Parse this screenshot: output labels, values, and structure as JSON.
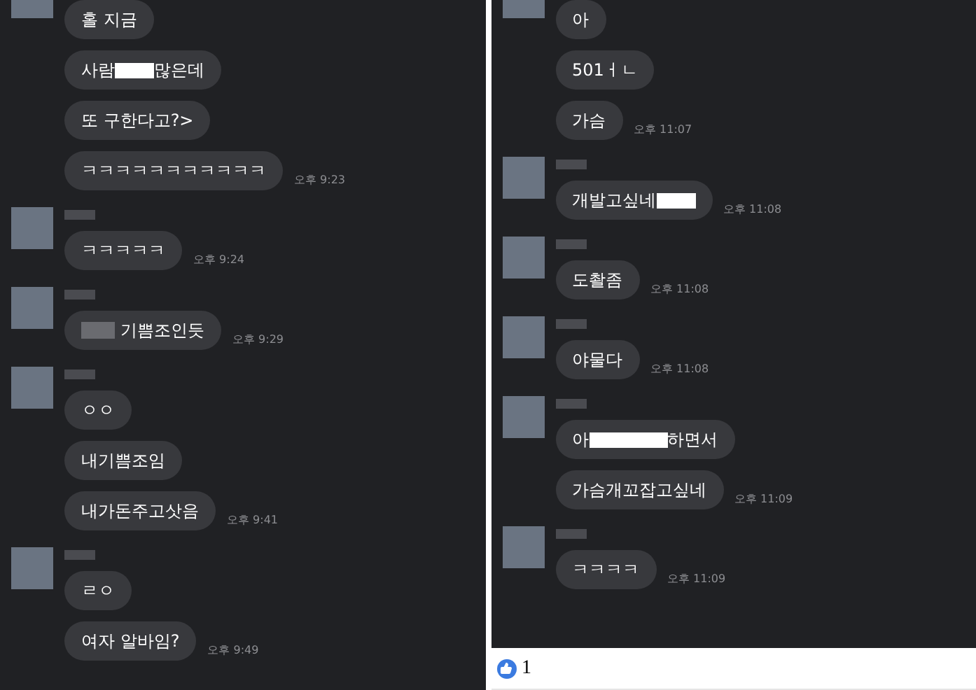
{
  "panels": [
    {
      "groups": [
        {
          "messages": [
            {
              "parts": [
                {
                  "kind": "text",
                  "text": "홀 지금"
                }
              ]
            },
            {
              "parts": [
                {
                  "kind": "text",
                  "text": "사람 "
                },
                {
                  "kind": "redacted"
                },
                {
                  "kind": "text",
                  "text": "많은데"
                }
              ]
            },
            {
              "parts": [
                {
                  "kind": "text",
                  "text": "또 구한다고?>"
                }
              ]
            },
            {
              "parts": [
                {
                  "kind": "text",
                  "text": "ㅋㅋㅋㅋㅋㅋㅋㅋㅋㅋㅋ"
                }
              ],
              "time": "오후 9:23"
            }
          ]
        },
        {
          "messages": [
            {
              "parts": [
                {
                  "kind": "text",
                  "text": "ㅋㅋㅋㅋㅋ"
                }
              ],
              "time": "오후 9:24"
            }
          ]
        },
        {
          "messages": [
            {
              "parts": [
                {
                  "kind": "blurred"
                },
                {
                  "kind": "text",
                  "text": "기쁨조인듯"
                }
              ],
              "time": "오후 9:29"
            }
          ]
        },
        {
          "messages": [
            {
              "parts": [
                {
                  "kind": "text",
                  "text": "ㅇㅇ"
                }
              ]
            },
            {
              "parts": [
                {
                  "kind": "text",
                  "text": "내기쁨조임"
                }
              ]
            },
            {
              "parts": [
                {
                  "kind": "text",
                  "text": "내가돈주고삿음"
                }
              ],
              "time": "오후 9:41"
            }
          ]
        },
        {
          "messages": [
            {
              "parts": [
                {
                  "kind": "text",
                  "text": "ㄹㅇ"
                }
              ]
            },
            {
              "parts": [
                {
                  "kind": "text",
                  "text": "여자 알바임?"
                }
              ],
              "time": "오후 9:49"
            }
          ]
        }
      ]
    },
    {
      "groups": [
        {
          "messages": [
            {
              "parts": [
                {
                  "kind": "text",
                  "text": "아"
                }
              ]
            },
            {
              "parts": [
                {
                  "kind": "text",
                  "text": "501ㅓㄴ"
                }
              ]
            },
            {
              "parts": [
                {
                  "kind": "text",
                  "text": "가슴"
                }
              ],
              "time": "오후 11:07"
            }
          ]
        },
        {
          "messages": [
            {
              "parts": [
                {
                  "kind": "text",
                  "text": "개발고싶네 "
                },
                {
                  "kind": "redacted"
                }
              ],
              "time": "오후 11:08"
            }
          ]
        },
        {
          "messages": [
            {
              "parts": [
                {
                  "kind": "text",
                  "text": "도촬좀"
                }
              ],
              "time": "오후 11:08"
            }
          ]
        },
        {
          "messages": [
            {
              "parts": [
                {
                  "kind": "text",
                  "text": "야물다"
                }
              ],
              "time": "오후 11:08"
            }
          ]
        },
        {
          "messages": [
            {
              "parts": [
                {
                  "kind": "text",
                  "text": "아 "
                },
                {
                  "kind": "redacted"
                },
                {
                  "kind": "redacted"
                },
                {
                  "kind": "text",
                  "text": "하면서"
                }
              ]
            },
            {
              "parts": [
                {
                  "kind": "text",
                  "text": "가슴개꼬잡고싶네"
                }
              ],
              "time": "오후 11:09"
            }
          ]
        },
        {
          "messages": [
            {
              "parts": [
                {
                  "kind": "text",
                  "text": "ㅋㅋㅋㅋ"
                }
              ],
              "time": "오후 11:09"
            }
          ]
        }
      ],
      "reactions": {
        "count": "1"
      }
    }
  ]
}
